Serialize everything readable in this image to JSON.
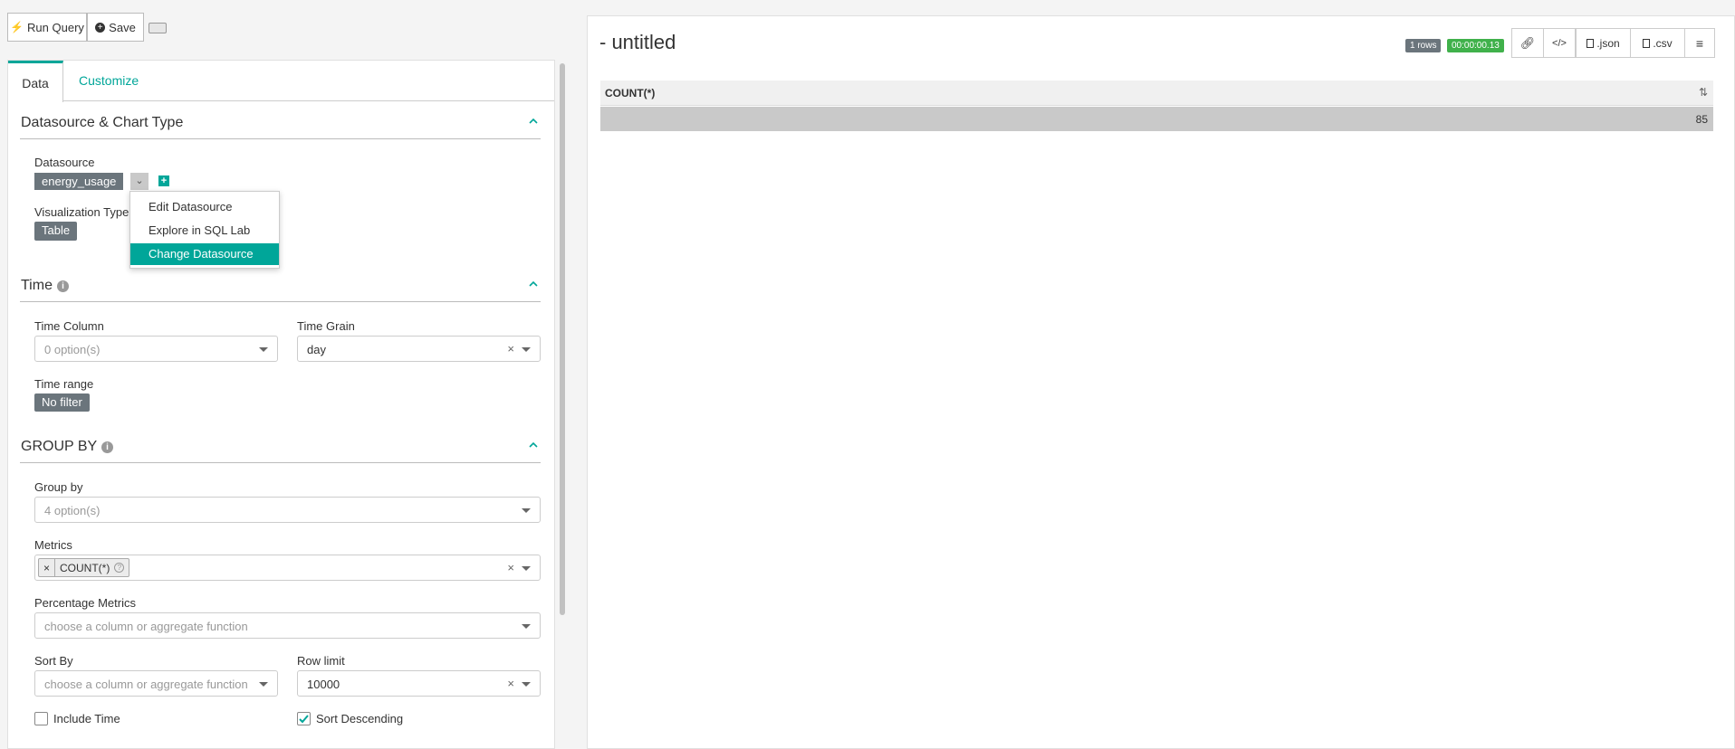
{
  "toolbar": {
    "run_query": "Run Query",
    "save": "Save"
  },
  "tabs": {
    "data": "Data",
    "customize": "Customize"
  },
  "sections": {
    "datasource": {
      "title": "Datasource & Chart Type",
      "datasource_label": "Datasource",
      "datasource_value": "energy_usage",
      "viz_label": "Visualization Type",
      "viz_value": "Table",
      "menu": [
        "Edit Datasource",
        "Explore in SQL Lab",
        "Change Datasource"
      ]
    },
    "time": {
      "title": "Time",
      "time_column_label": "Time Column",
      "time_column_placeholder": "0 option(s)",
      "time_grain_label": "Time Grain",
      "time_grain_value": "day",
      "time_range_label": "Time range",
      "time_range_value": "No filter"
    },
    "groupby": {
      "title": "GROUP BY",
      "group_by_label": "Group by",
      "group_by_placeholder": "4 option(s)",
      "metrics_label": "Metrics",
      "metrics_chip": "COUNT(*)",
      "pct_metrics_label": "Percentage Metrics",
      "pct_metrics_placeholder": "choose a column or aggregate function",
      "sort_by_label": "Sort By",
      "sort_by_placeholder": "choose a column or aggregate function",
      "row_limit_label": "Row limit",
      "row_limit_value": "10000",
      "include_time_label": "Include Time",
      "sort_desc_label": "Sort Descending"
    }
  },
  "chart": {
    "title": "- untitled",
    "rows_badge": "1 rows",
    "time_badge": "00:00:00.13",
    "json_label": ".json",
    "csv_label": ".csv",
    "table": {
      "column": "COUNT(*)",
      "rows": [
        "85"
      ]
    }
  },
  "colors": {
    "accent": "#00a699",
    "chip": "#6b757c",
    "success": "#40b14b"
  }
}
